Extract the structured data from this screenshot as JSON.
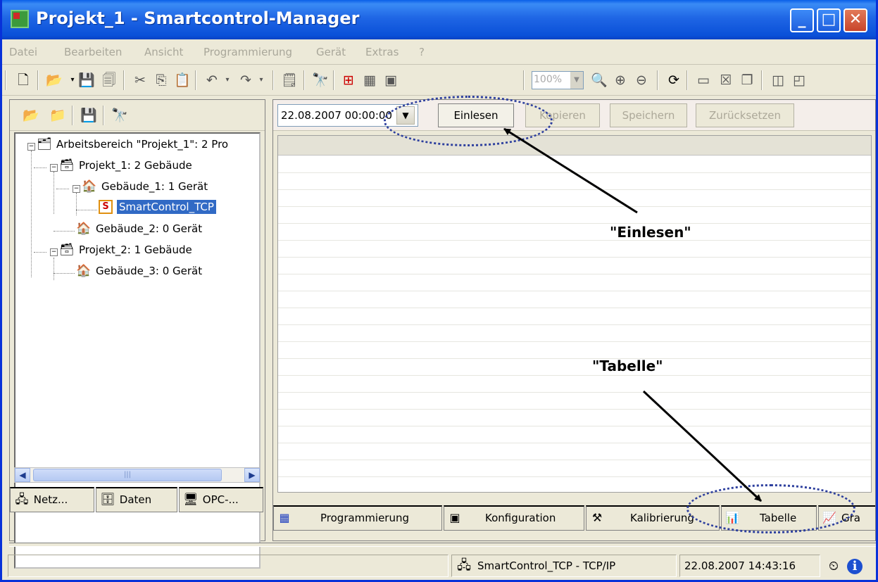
{
  "window": {
    "title": "Projekt_1 - Smartcontrol-Manager",
    "controls": {
      "minimize": "_",
      "maximize": "□",
      "close": "✕"
    }
  },
  "menu": [
    "Datei",
    "Bearbeiten",
    "Ansicht",
    "Programmierung",
    "Gerät",
    "Extras",
    "?"
  ],
  "toolbar": {
    "zoom": "100%"
  },
  "tree": {
    "root": "Arbeitsbereich \"Projekt_1\": 2 Pro",
    "projekt1": "Projekt_1: 2 Gebäude",
    "gebaeude1": "Gebäude_1: 1 Gerät",
    "device": "SmartControl_TCP",
    "device_icon_letter": "S",
    "gebaeude2": "Gebäude_2: 0 Gerät",
    "projekt2": "Projekt_2: 1 Gebäude",
    "gebaeude3": "Gebäude_3: 0 Gerät"
  },
  "left_tabs": [
    "Netz...",
    "Daten",
    "OPC-..."
  ],
  "right_toolbar": {
    "date": "22.08.2007 00:00:00",
    "einlesen": "Einlesen",
    "kopieren": "Kopieren",
    "speichern": "Speichern",
    "zuruecksetzen": "Zurücksetzen"
  },
  "right_tabs": [
    "Programmierung",
    "Konfiguration",
    "Kalibrierung",
    "Tabelle",
    "Gra"
  ],
  "status": {
    "connection": "SmartControl_TCP - TCP/IP",
    "datetime": "22.08.2007 14:43:16"
  },
  "annotations": {
    "einlesen": "\"Einlesen\"",
    "tabelle": "\"Tabelle\""
  },
  "colors": {
    "title_bar": "#0a50d8",
    "selection": "#316ac5",
    "annotation_dots": "#2d3f9e"
  }
}
